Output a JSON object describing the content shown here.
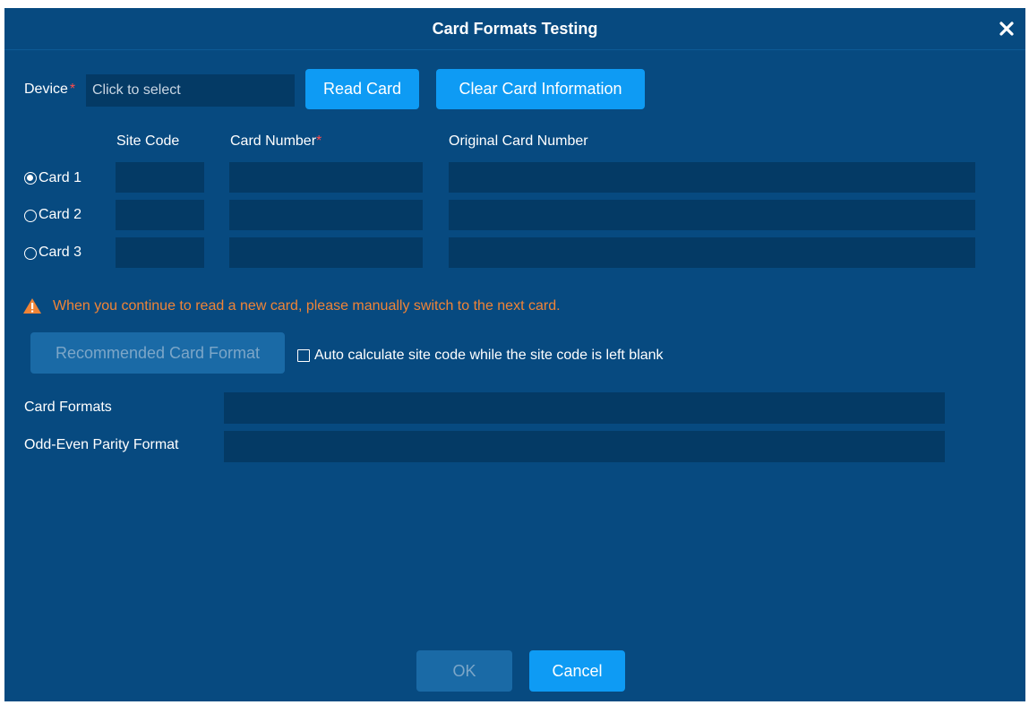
{
  "dialog": {
    "title": "Card Formats Testing"
  },
  "device": {
    "label": "Device",
    "required_mark": "*",
    "value": "Click to select"
  },
  "buttons": {
    "read_card": "Read Card",
    "clear_card": "Clear Card Information",
    "recommended": "Recommended Card Format",
    "ok": "OK",
    "cancel": "Cancel"
  },
  "table": {
    "headers": {
      "site_code": "Site Code",
      "card_number": "Card Number",
      "card_number_required": "*",
      "original_card_number": "Original Card Number"
    },
    "rows": [
      {
        "label": "Card 1",
        "selected": true,
        "site_code": "",
        "card_number": "",
        "original": ""
      },
      {
        "label": "Card 2",
        "selected": false,
        "site_code": "",
        "card_number": "",
        "original": ""
      },
      {
        "label": "Card 3",
        "selected": false,
        "site_code": "",
        "card_number": "",
        "original": ""
      }
    ]
  },
  "warning": {
    "icon": "warning-triangle-icon",
    "text": "When you continue to read a new card, please manually switch to the next card."
  },
  "auto_calc": {
    "checked": false,
    "label": "Auto calculate site code while the site code is left blank"
  },
  "results": {
    "card_formats_label": "Card Formats",
    "card_formats_value": "",
    "parity_label": "Odd-Even Parity Format",
    "parity_value": ""
  },
  "colors": {
    "background": "#074a80",
    "field": "#043a65",
    "primary_button": "#0e9bf4",
    "disabled_button": "#1a6aa6",
    "warning": "#f08436",
    "required": "#ff4b4b"
  }
}
